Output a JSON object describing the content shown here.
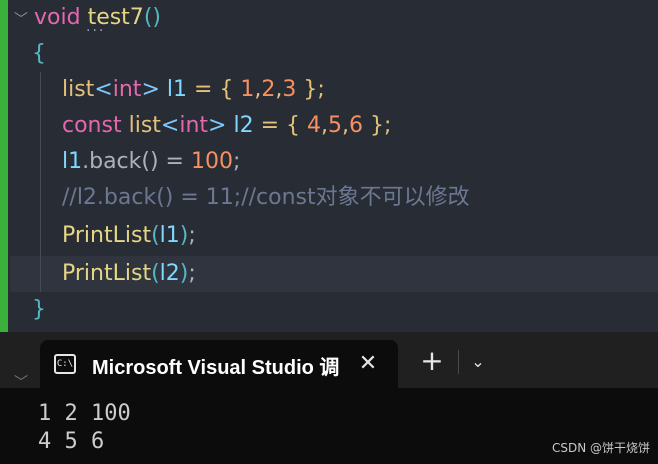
{
  "editor": {
    "fn_keyword": "void",
    "fn_name": "test7",
    "open_paren": "(",
    "close_paren": ")",
    "open_brace": "{",
    "close_brace": "}",
    "line3": {
      "type1": "list",
      "lt": "<",
      "type2": "int",
      "gt": ">",
      "var": "l1",
      "eq": " = { ",
      "n1": "1",
      "c1": ",",
      "n2": "2",
      "c2": ",",
      "n3": "3",
      "end": " };"
    },
    "line4": {
      "kw": "const",
      "type1": "list",
      "lt": "<",
      "type2": "int",
      "gt": ">",
      "var": "l2",
      "eq": " = { ",
      "n1": "4",
      "c1": ",",
      "n2": "5",
      "c2": ",",
      "n3": "6",
      "end": " };"
    },
    "line5": {
      "var": "l1",
      "method": ".back()",
      "eq": " = ",
      "num": "100",
      "end": ";"
    },
    "line6_comment": "//l2.back() = 11;//const对象不可以修改",
    "line7": {
      "fn": "PrintList",
      "open": "(",
      "arg": "l1",
      "close": ")",
      "end": ";"
    },
    "line8": {
      "fn": "PrintList",
      "open": "(",
      "arg": "l2",
      "close": ")",
      "end": ";"
    },
    "dots": "···"
  },
  "terminal": {
    "tab_icon_text": "C:\\",
    "tab_title": "Microsoft Visual Studio 调",
    "close_glyph": "✕",
    "new_tab_glyph": "+",
    "dropdown_glyph": "⌄",
    "output": [
      "1 2 100",
      "4 5 6"
    ]
  },
  "watermark": "CSDN @饼干烧饼"
}
